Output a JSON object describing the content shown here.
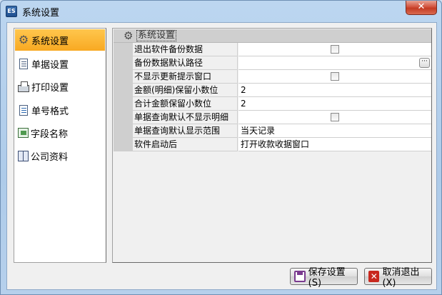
{
  "window": {
    "title": "系统设置",
    "app_icon_text": "ES",
    "close_glyph": "✕"
  },
  "sidebar": {
    "items": [
      {
        "label": "系统设置",
        "icon": "gear-icon",
        "active": true
      },
      {
        "label": "单据设置",
        "icon": "document-icon",
        "active": false
      },
      {
        "label": "打印设置",
        "icon": "printer-icon",
        "active": false
      },
      {
        "label": "单号格式",
        "icon": "number-format-icon",
        "active": false
      },
      {
        "label": "字段名称",
        "icon": "field-icon",
        "active": false
      },
      {
        "label": "公司资料",
        "icon": "book-icon",
        "active": false
      }
    ]
  },
  "settings": {
    "group_title": "系统设置",
    "rows": [
      {
        "label": "退出软件备份数据",
        "value": "",
        "control": "checkbox",
        "checked": false
      },
      {
        "label": "备份数据默认路径",
        "value": "",
        "control": "ellipsis",
        "button_text": "···"
      },
      {
        "label": "不显示更新提示窗口",
        "value": "",
        "control": "checkbox",
        "checked": false
      },
      {
        "label": "金额(明细)保留小数位",
        "value": "2",
        "control": "text"
      },
      {
        "label": "合计金额保留小数位",
        "value": "2",
        "control": "text"
      },
      {
        "label": "单据查询默认不显示明细",
        "value": "",
        "control": "checkbox",
        "checked": false
      },
      {
        "label": "单据查询默认显示范围",
        "value": "当天记录",
        "control": "select"
      },
      {
        "label": "软件启动后",
        "value": "打开收款收据窗口",
        "control": "select"
      }
    ]
  },
  "footer": {
    "save_label": "保存设置(S)",
    "cancel_label": "取消退出(X)"
  },
  "colors": {
    "active_nav": "#f8a922",
    "header_gray": "#cfcfcf"
  }
}
